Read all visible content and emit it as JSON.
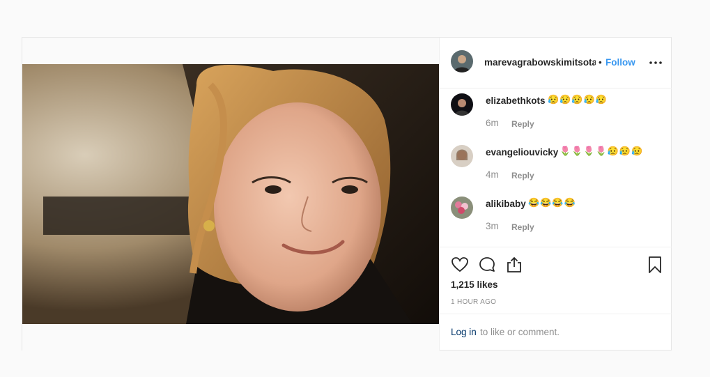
{
  "post": {
    "author": "marevagrabowskimitsotal",
    "separator": "•",
    "follow_label": "Follow",
    "more_icon": "more-options-icon"
  },
  "comments": [
    {
      "user": "elizabethkots",
      "emoji": "😥😥😥😥😥",
      "time": "6m",
      "reply": "Reply"
    },
    {
      "user": "evangeliouvicky",
      "emoji": "🌷🌷🌷🌷😥😥😥",
      "time": "4m",
      "reply": "Reply"
    },
    {
      "user": "alikibaby",
      "emoji": "😂😂😂😂",
      "time": "3m",
      "reply": "Reply"
    }
  ],
  "actions": {
    "like_icon": "heart-icon",
    "comment_icon": "comment-icon",
    "share_icon": "share-icon",
    "save_icon": "bookmark-icon"
  },
  "likes": "1,215 likes",
  "timestamp": "1 HOUR AGO",
  "login": {
    "link": "Log in",
    "rest": "to like or comment."
  },
  "colors": {
    "accent": "#3897f0",
    "login_link": "#003569",
    "muted": "#8e8e8e"
  }
}
